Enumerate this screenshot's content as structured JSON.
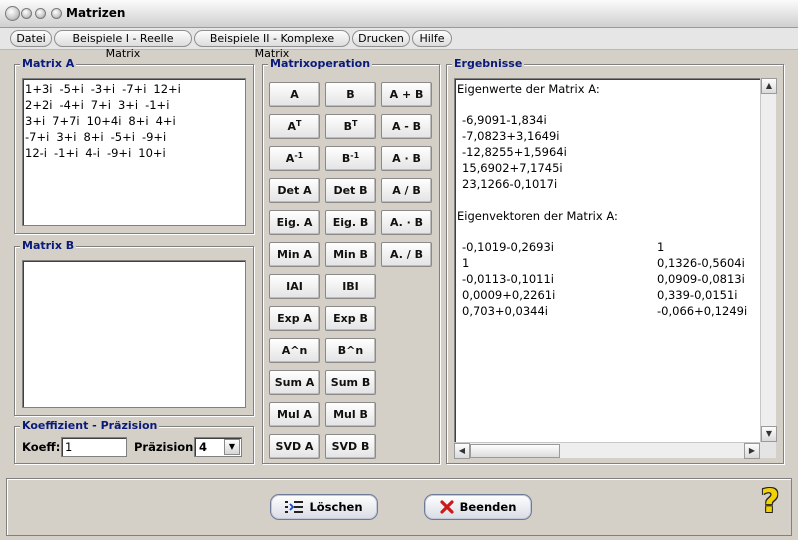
{
  "window": {
    "title": "Matrizen"
  },
  "menu": [
    {
      "label": "Datei"
    },
    {
      "label": "Beispiele I - Reelle Matrix"
    },
    {
      "label": "Beispiele II - Komplexe Matrix"
    },
    {
      "label": "Drucken"
    },
    {
      "label": "Hilfe"
    }
  ],
  "matrix_a": {
    "title": "Matrix A",
    "rows": [
      [
        "1+3i",
        "-5+i",
        "-3+i",
        "-7+i",
        "12+i"
      ],
      [
        "2+2i",
        "-4+i",
        "7+i",
        "3+i",
        "-1+i"
      ],
      [
        "3+i",
        "7+7i",
        "10+4i",
        "8+i",
        "4+i"
      ],
      [
        "-7+i",
        "3+i",
        "8+i",
        "-5+i",
        "-9+i"
      ],
      [
        "12-i",
        "-1+i",
        "4-i",
        "-9+i",
        "10+i"
      ]
    ]
  },
  "matrix_b": {
    "title": "Matrix B",
    "value": ""
  },
  "koeff": {
    "title": "Koeffizient - Präzision",
    "koeff_label": "Koeff:",
    "koeff_value": "1",
    "praezision_label": "Präzision:",
    "praezision_value": "4"
  },
  "ops": {
    "title": "Matrixoperation",
    "buttons": [
      {
        "label": "A",
        "sup": ""
      },
      {
        "label": "B",
        "sup": ""
      },
      {
        "label": "A + B",
        "sup": ""
      },
      {
        "label": "A",
        "sup": "T"
      },
      {
        "label": "B",
        "sup": "T"
      },
      {
        "label": "A - B",
        "sup": ""
      },
      {
        "label": "A",
        "sup": "-1"
      },
      {
        "label": "B",
        "sup": "-1"
      },
      {
        "label": "A · B",
        "sup": ""
      },
      {
        "label": "Det A",
        "sup": ""
      },
      {
        "label": "Det B",
        "sup": ""
      },
      {
        "label": "A / B",
        "sup": ""
      },
      {
        "label": "Eig. A",
        "sup": ""
      },
      {
        "label": "Eig. B",
        "sup": ""
      },
      {
        "label": "A. · B",
        "sup": ""
      },
      {
        "label": "Min A",
        "sup": ""
      },
      {
        "label": "Min B",
        "sup": ""
      },
      {
        "label": "A. / B",
        "sup": ""
      },
      {
        "label": "IAI",
        "sup": ""
      },
      {
        "label": "IBI",
        "sup": ""
      },
      {
        "label": "Exp A",
        "sup": ""
      },
      {
        "label": "Exp B",
        "sup": ""
      },
      {
        "label": "A^n",
        "sup": ""
      },
      {
        "label": "B^n",
        "sup": ""
      },
      {
        "label": "Sum A",
        "sup": ""
      },
      {
        "label": "Sum B",
        "sup": ""
      },
      {
        "label": "Mul A",
        "sup": ""
      },
      {
        "label": "Mul B",
        "sup": ""
      },
      {
        "label": "SVD A",
        "sup": ""
      },
      {
        "label": "SVD B",
        "sup": ""
      }
    ]
  },
  "results": {
    "title": "Ergebnisse",
    "eigenwerte_heading": "Eigenwerte der Matrix A:",
    "eigenwerte": [
      "-6,9091-1,834i",
      "-7,0823+3,1649i",
      "-12,8255+1,5964i",
      "15,6902+7,1745i",
      "23,1266-0,1017i"
    ],
    "eigenvektoren_heading": "Eigenvektoren der Matrix A:",
    "eigenvektoren": [
      [
        "-0,1019-0,2693i",
        "1"
      ],
      [
        "1",
        "0,1326-0,5604i"
      ],
      [
        "-0,0113-0,1011i",
        "0,0909-0,0813i"
      ],
      [
        "0,0009+0,2261i",
        "0,339-0,0151i"
      ],
      [
        "0,703+0,0344i",
        "-0,066+0,1249i"
      ]
    ]
  },
  "bottom": {
    "loeschen_label": "Löschen",
    "beenden_label": "Beenden",
    "help_glyph": "?"
  },
  "colors": {
    "group_title": "#0a1a7a",
    "close_x": "#cc1a1a"
  }
}
